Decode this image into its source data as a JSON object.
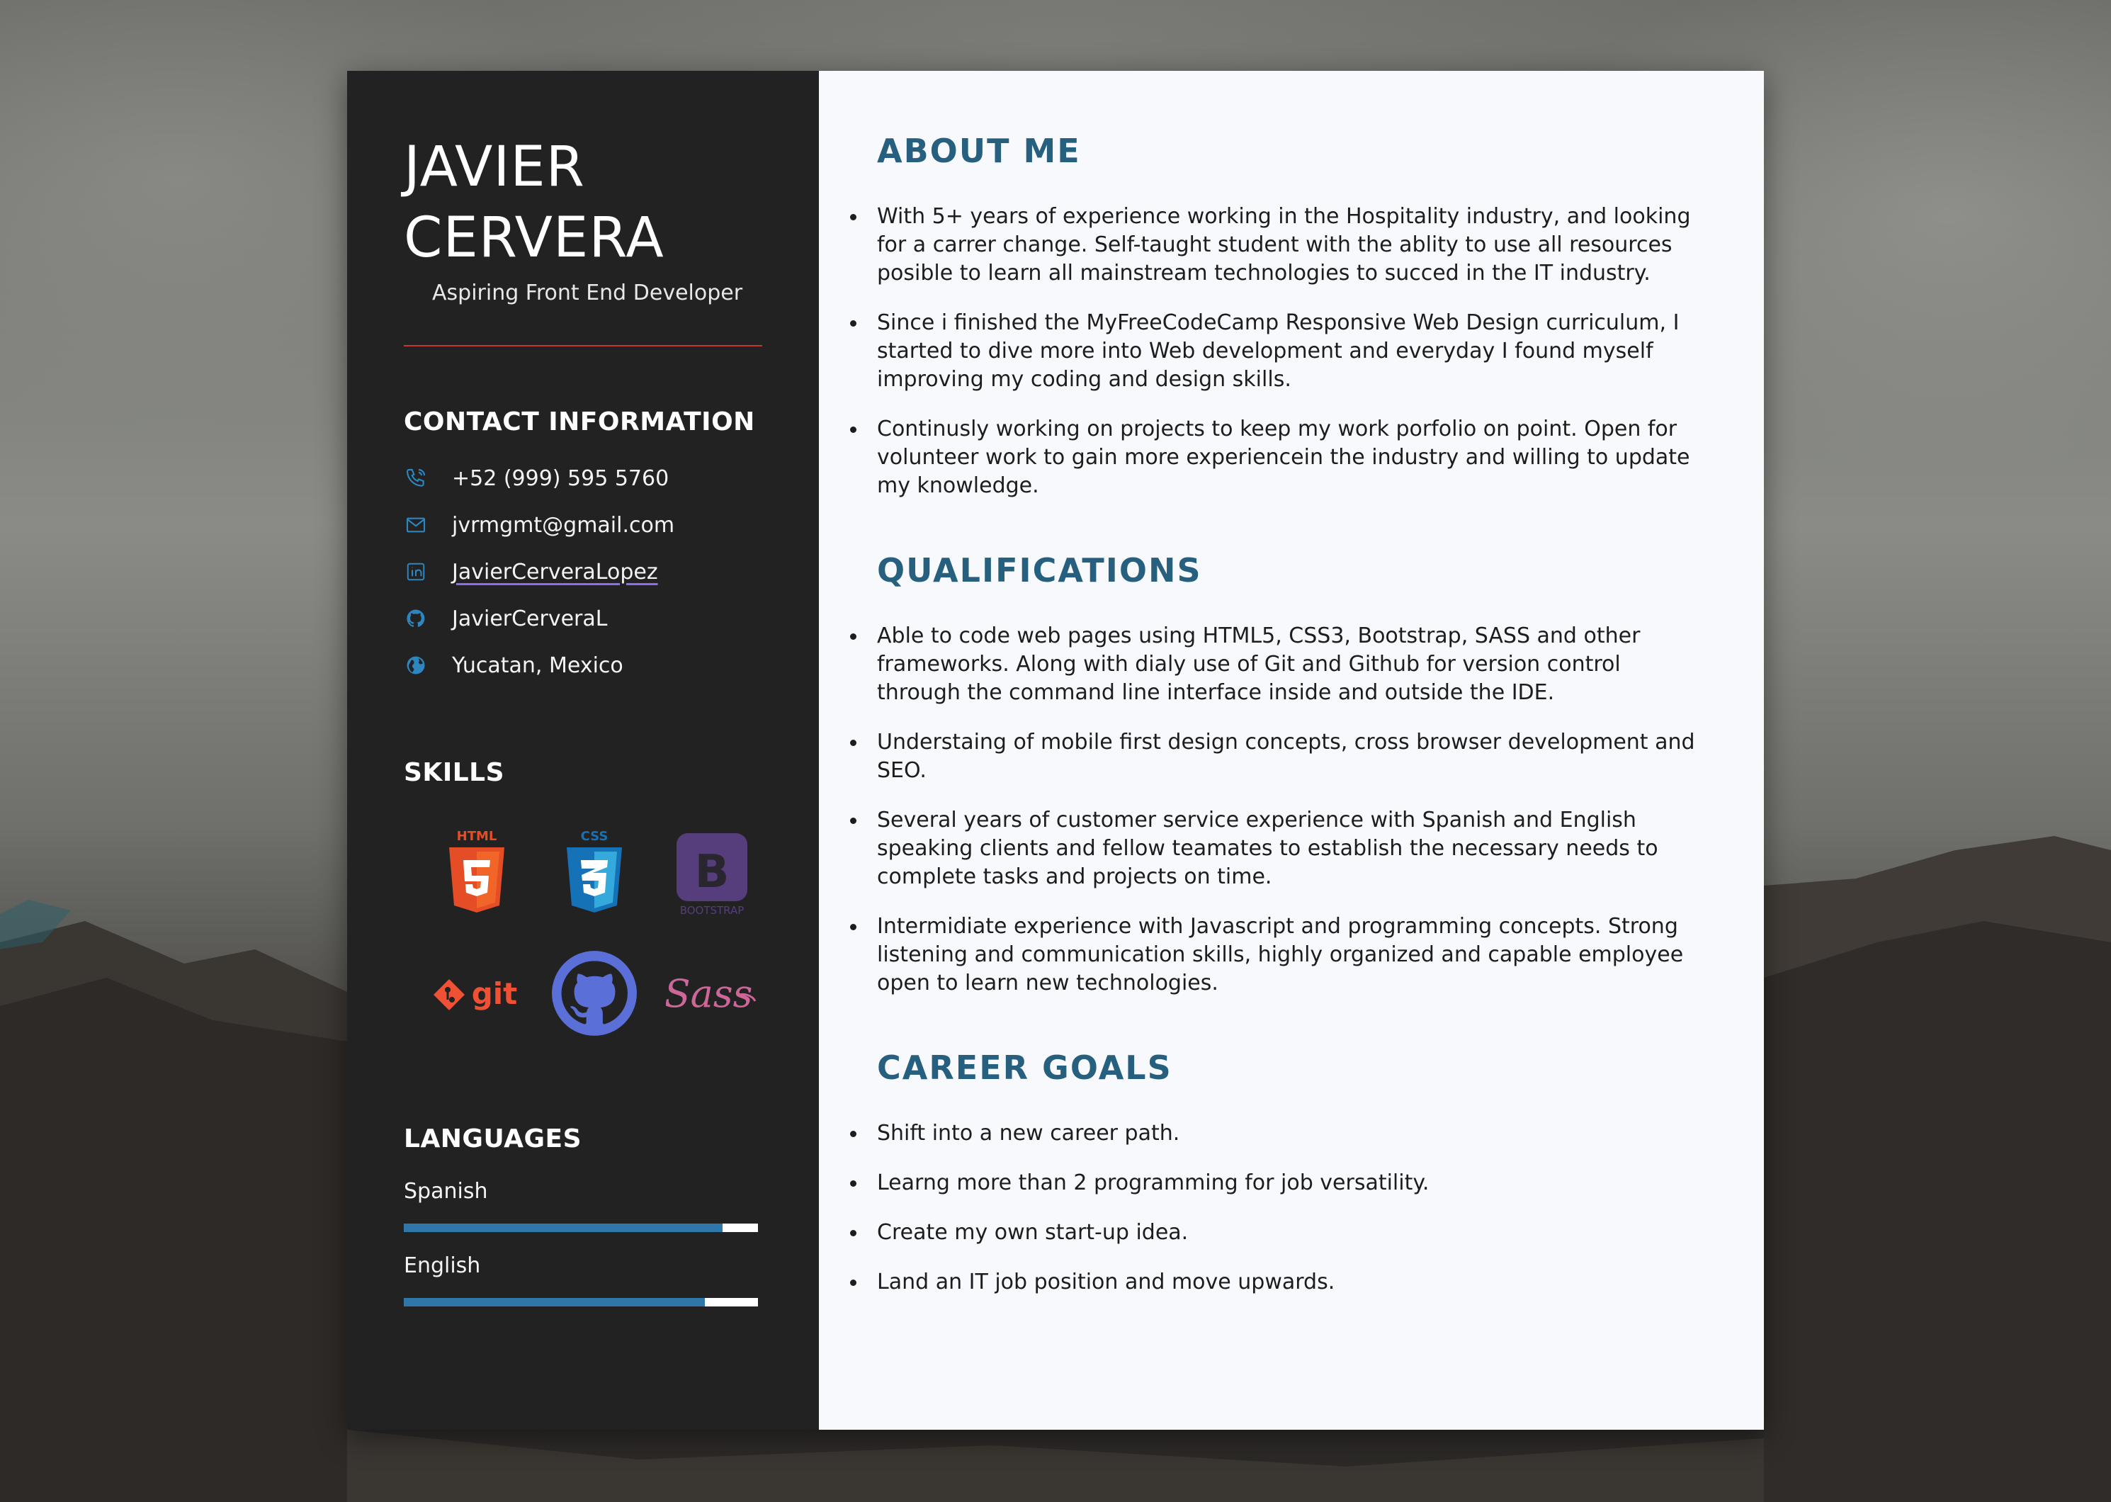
{
  "profile": {
    "name": "JAVIER\nCERVERA",
    "title": "Aspiring Front End Developer"
  },
  "contact": {
    "heading": "CONTACT INFORMATION",
    "items": [
      {
        "icon": "phone-icon",
        "text": "+52 (999) 595 5760"
      },
      {
        "icon": "mail-icon",
        "text": "jvrmgmt@gmail.com"
      },
      {
        "icon": "linkedin-icon",
        "text": "JavierCerveraLopez"
      },
      {
        "icon": "github-icon",
        "text": "JavierCerveraL"
      },
      {
        "icon": "globe-icon",
        "text": "Yucatan, Mexico"
      }
    ]
  },
  "skills": {
    "heading": "SKILLS",
    "logos": [
      {
        "name": "html5-logo",
        "label": "HTML"
      },
      {
        "name": "css3-logo",
        "label": "CSS"
      },
      {
        "name": "bootstrap-logo",
        "label": "BOOTSTRAP"
      },
      {
        "name": "git-logo",
        "label": "git"
      },
      {
        "name": "github-logo",
        "label": ""
      },
      {
        "name": "sass-logo",
        "label": "Sass"
      }
    ]
  },
  "languages": {
    "heading": "LANGUAGES",
    "items": [
      {
        "name": "Spanish",
        "level": 0.9
      },
      {
        "name": "English",
        "level": 0.85
      }
    ]
  },
  "sections": [
    {
      "heading": "ABOUT ME",
      "items": [
        "With 5+ years of experience working in the Hospitality industry, and looking for a carrer change. Self-taught student with the ablity to use all resources posible to learn all mainstream technologies to succed in the IT industry.",
        "Since i finished the MyFreeCodeCamp Responsive Web Design curriculum, I started to dive more into Web development and everyday I found myself improving my coding and design skills.",
        "Continusly working on projects to keep my work porfolio on point. Open for volunteer work to gain more experiencein the industry and willing to update my knowledge."
      ]
    },
    {
      "heading": "QUALIFICATIONS",
      "items": [
        "Able to code web pages using HTML5, CSS3, Bootstrap, SASS and other frameworks. Along with dialy use of Git and Github for version control through the command line interface inside and outside the IDE.",
        "Understaing of mobile first design concepts, cross browser development and SEO.",
        "Several years of customer service experience with Spanish and English speaking clients and fellow teamates to establish the necessary needs to complete tasks and projects on time.",
        "Intermidiate experience with Javascript and programming concepts. Strong listening and communication skills, highly organized and capable employee open to learn new technologies."
      ]
    },
    {
      "heading": "CAREER GOALS",
      "items": [
        "Shift into a new career path.",
        "Learng more than 2 programming for job versatility.",
        "Create my own start-up idea.",
        "Land an IT job position and move upwards."
      ]
    }
  ],
  "colors": {
    "accent": "#27607f",
    "divider": "#c0392b",
    "icon": "#2e86c1",
    "bar": "#2e77a8"
  }
}
